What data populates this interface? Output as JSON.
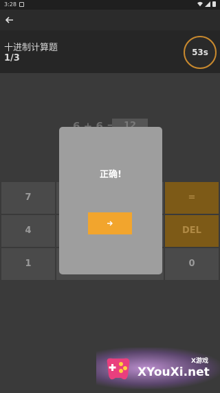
{
  "status": {
    "time": "3:28"
  },
  "header": {
    "title": "十进制计算题",
    "progress": "1/3",
    "timer": "53s"
  },
  "equation": {
    "expression": "6 + 6 =",
    "answer": "12"
  },
  "keypad": {
    "keys": [
      {
        "label": "7"
      },
      {
        "label": "4"
      },
      {
        "label": "1"
      },
      {
        "label": "="
      },
      {
        "label": "DEL"
      },
      {
        "label": "0"
      }
    ]
  },
  "dialog": {
    "title": "正确!"
  },
  "watermark": {
    "small": "X游戏",
    "site": "XYouXi.net"
  },
  "colors": {
    "accent": "#f2a52d",
    "dialog_bg": "#9e9e9e",
    "timer_ring": "#c8892e"
  }
}
